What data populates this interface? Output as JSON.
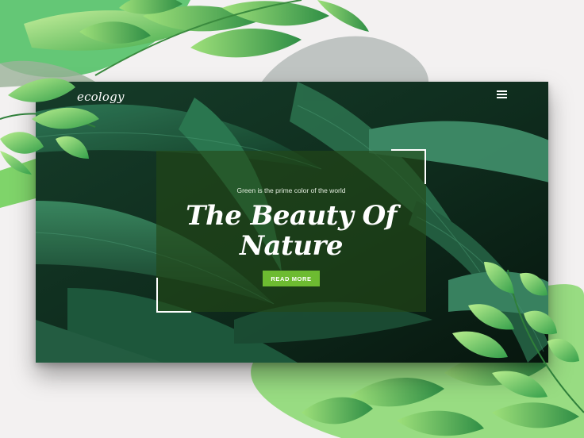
{
  "brand": {
    "logo_text": "ecology"
  },
  "hero": {
    "subtitle": "Green is the prime color of the world",
    "title_line1": "The Beauty Of",
    "title_line2": "Nature",
    "cta_label": "READ MORE"
  },
  "icons": {
    "menu": "hamburger-menu-icon"
  },
  "colors": {
    "accent": "#6dbb31",
    "panel_overlay": "#244816",
    "page_background": "#f3f1f1",
    "leaf_light": "#7fd46a",
    "leaf_dark": "#1f5a3a"
  }
}
